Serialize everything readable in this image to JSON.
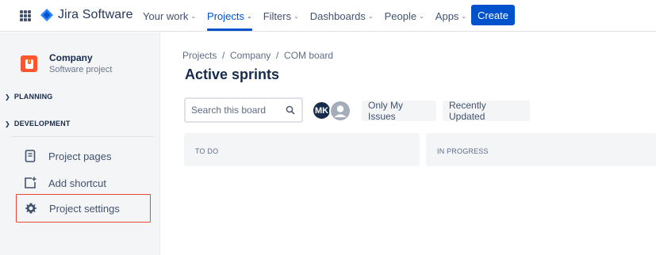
{
  "topnav": {
    "logo_text": "Jira Software",
    "items": [
      {
        "label": "Your work",
        "active": false
      },
      {
        "label": "Projects",
        "active": true
      },
      {
        "label": "Filters",
        "active": false
      },
      {
        "label": "Dashboards",
        "active": false
      },
      {
        "label": "People",
        "active": false
      },
      {
        "label": "Apps",
        "active": false
      }
    ],
    "create_label": "Create",
    "accent_color": "#0052cc"
  },
  "sidebar": {
    "project_name": "Company",
    "project_type": "Software project",
    "sections": [
      {
        "label": "PLANNING"
      },
      {
        "label": "DEVELOPMENT"
      }
    ],
    "items": [
      {
        "label": "Project pages",
        "icon": "page-icon"
      },
      {
        "label": "Add shortcut",
        "icon": "add-shortcut-icon"
      },
      {
        "label": "Project settings",
        "icon": "gear-icon",
        "highlighted": true
      }
    ]
  },
  "main": {
    "breadcrumb": "Projects  /  Company  /  COM board",
    "title": "Active sprints",
    "search_placeholder": "Search this board",
    "avatars": [
      {
        "initials": "MK"
      },
      {
        "initials": ""
      }
    ],
    "filters": [
      "Only My Issues",
      "Recently Updated"
    ],
    "columns": [
      "TO DO",
      "IN PROGRESS"
    ]
  }
}
